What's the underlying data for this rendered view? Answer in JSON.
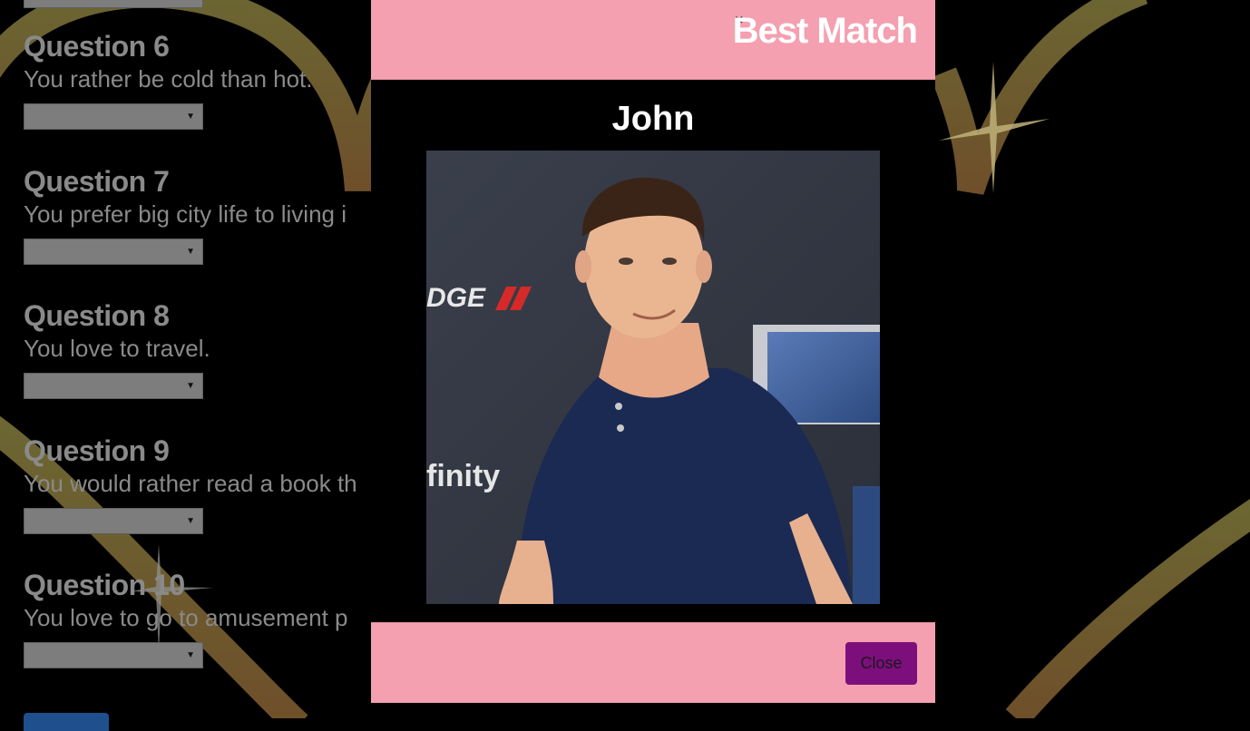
{
  "form": {
    "questions": [
      {
        "title": "Question 6",
        "text": "You rather be cold than hot."
      },
      {
        "title": "Question 7",
        "text": "You prefer big city life to living i"
      },
      {
        "title": "Question 8",
        "text": "You love to travel."
      },
      {
        "title": "Question 9",
        "text": "You would rather read a book th"
      },
      {
        "title": "Question 10",
        "text": "You love to go to amusement p"
      }
    ],
    "select_arrow": "▼"
  },
  "modal": {
    "title": "Best Match",
    "close_icon": "×",
    "match_name": "John",
    "close_button_label": "Close"
  },
  "colors": {
    "header_pink": "#f4a0b0",
    "close_button_purple": "#7d0f7d",
    "background": "#000000",
    "heart_gold": "#8a7a3a"
  }
}
